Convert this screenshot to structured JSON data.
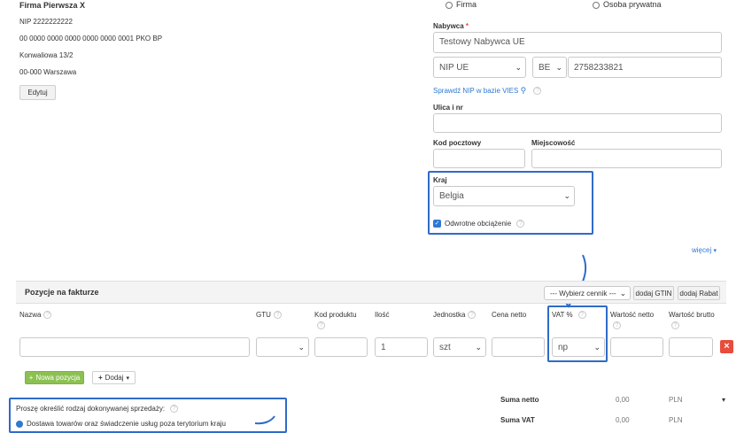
{
  "seller": {
    "name": "Firma Pierwsza X",
    "nip": "NIP 2222222222",
    "account": "00 0000 0000 0000 0000 0000 0001 PKO BP",
    "street": "Konwaliowa 13/2",
    "city": "00-000 Warszawa",
    "edit_label": "Edytuj"
  },
  "buyer_type": {
    "company": "Firma",
    "private": "Osoba prywatna"
  },
  "buyer": {
    "label": "Nabywca",
    "required_mark": "*",
    "value": "Testowy Nabywca UE",
    "nip_type": "NIP UE",
    "country_code": "BE",
    "nip_value": "2758233821",
    "vies_link": "Sprawdź NIP w bazie VIES",
    "street_label": "Ulica i nr",
    "postal_label": "Kod pocztowy",
    "city_label": "Miejscowość",
    "country_label": "Kraj",
    "country_value": "Belgia",
    "reverse_charge_label": "Odwrotne obciążenie",
    "more_label": "więcej"
  },
  "items": {
    "title": "Pozycje na fakturze",
    "pricelist_placeholder": "--- Wybierz cennik ---",
    "add_gtin": "dodaj GTIN",
    "add_discount": "dodaj Rabat",
    "columns": {
      "name": "Nazwa",
      "gtu": "GTU",
      "product_code": "Kod produktu",
      "quantity": "Ilość",
      "unit": "Jednostka",
      "net_price": "Cena netto",
      "vat": "VAT %",
      "net_value": "Wartość netto",
      "gross_value": "Wartość brutto"
    },
    "row": {
      "quantity": "1",
      "unit": "szt",
      "vat": "np",
      "delete_icon": "×"
    },
    "new_item": "Nowa pozycja",
    "add": "Dodaj"
  },
  "sale_type": {
    "question": "Proszę określić rodzaj dokonywanej sprzedaży:",
    "option1": "Dostawa towarów oraz świadczenie usług poza terytorium kraju"
  },
  "totals": {
    "net_label": "Suma netto",
    "net_value": "0,00",
    "vat_label": "Suma VAT",
    "vat_value": "0,00",
    "currency": "PLN"
  },
  "colors": {
    "accent_blue": "#2f6bc8",
    "green_button": "#8cc152",
    "delete_red": "#e74c3c"
  }
}
